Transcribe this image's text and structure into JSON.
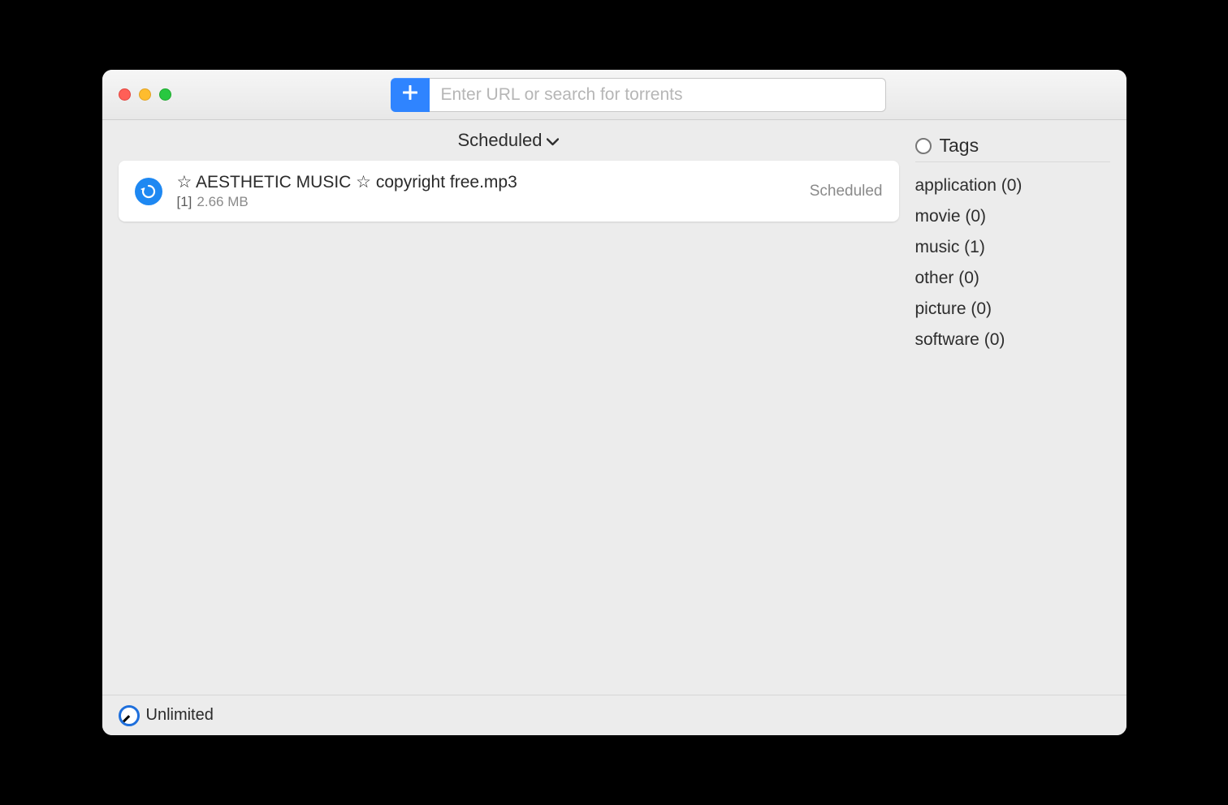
{
  "toolbar": {
    "search_placeholder": "Enter URL or search for torrents"
  },
  "filter": {
    "label": "Scheduled"
  },
  "downloads": [
    {
      "name": "☆ AESTHETIC MUSIC ☆ copyright free.mp3",
      "index": "[1]",
      "size": "2.66 MB",
      "status": "Scheduled"
    }
  ],
  "tags": {
    "header": "Tags",
    "items": [
      {
        "label": "application",
        "count": 0
      },
      {
        "label": "movie",
        "count": 0
      },
      {
        "label": "music",
        "count": 1
      },
      {
        "label": "other",
        "count": 0
      },
      {
        "label": "picture",
        "count": 0
      },
      {
        "label": "software",
        "count": 0
      }
    ]
  },
  "footer": {
    "speed_label": "Unlimited"
  }
}
